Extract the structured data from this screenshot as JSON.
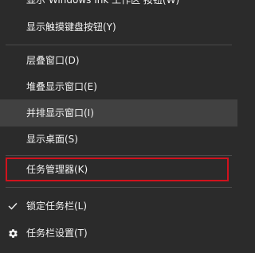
{
  "context_menu": {
    "items": [
      {
        "label": "显示 Windows Ink 工作区 按钮(W)"
      },
      {
        "label": "显示触摸键盘按钮(Y)"
      },
      {
        "label": "层叠窗口(D)"
      },
      {
        "label": "堆叠显示窗口(E)"
      },
      {
        "label": "并排显示窗口(I)",
        "state": "hover"
      },
      {
        "label": "显示桌面(S)"
      },
      {
        "label": "任务管理器(K)",
        "state": "highlighted"
      },
      {
        "label": "锁定任务栏(L)",
        "checked": true,
        "icon": "checkmark-icon"
      },
      {
        "label": "任务栏设置(T)",
        "icon": "gear-icon"
      }
    ],
    "colors": {
      "background": "#2b2b2b",
      "hover": "#414141",
      "text": "#f2f2f2",
      "separator": "#4a4a4a",
      "highlight_border": "#d1121d"
    }
  }
}
